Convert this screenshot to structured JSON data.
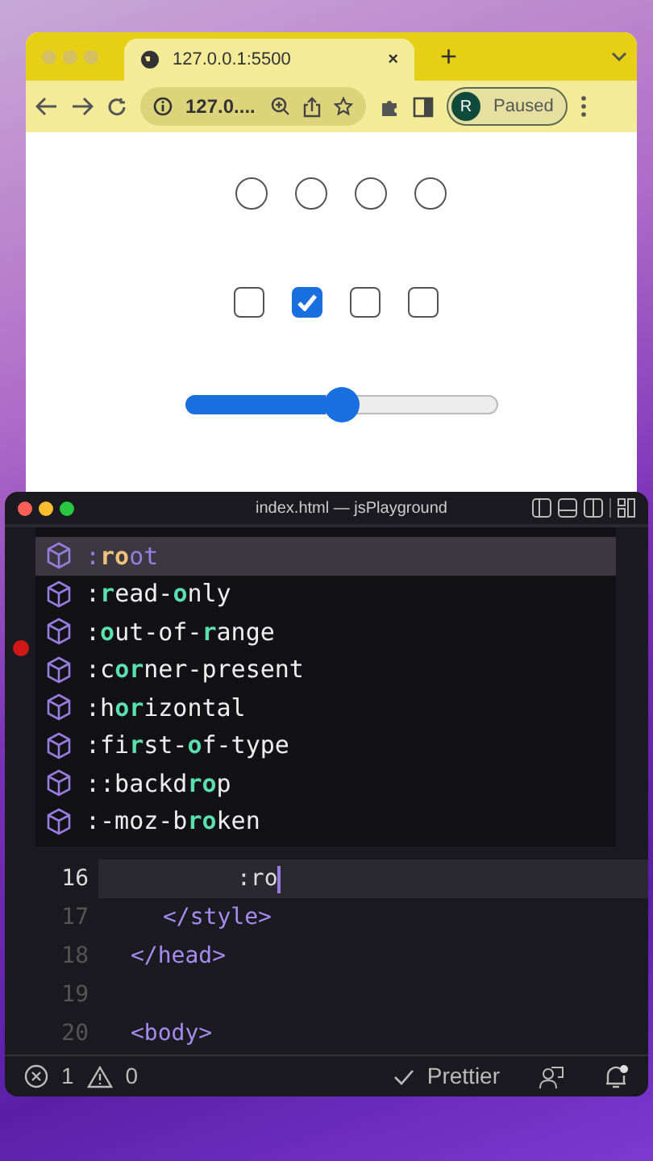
{
  "browser": {
    "tab": {
      "title": "127.0.0.1:5500",
      "close": "×"
    },
    "new_tab": "+",
    "address": "127.0....",
    "profile": {
      "initial": "R",
      "label": "Paused"
    }
  },
  "page": {
    "radios": [
      {
        "selected": false
      },
      {
        "selected": false
      },
      {
        "selected": false
      },
      {
        "selected": false
      }
    ],
    "checkboxes": [
      {
        "checked": false
      },
      {
        "checked": true
      },
      {
        "checked": false
      },
      {
        "checked": false
      }
    ],
    "slider": {
      "level": 0.5
    }
  },
  "editor": {
    "title": "index.html — jsPlayground",
    "suggestions": [
      {
        "label": ":**ro**ot",
        "selected": true
      },
      {
        "label": ":**r**ead-**o**nly",
        "selected": false
      },
      {
        "label": ":**o**ut-of-**r**ange",
        "selected": false
      },
      {
        "label": ":c**or**ner-present",
        "selected": false
      },
      {
        "label": ":h**or**izontal",
        "selected": false
      },
      {
        "label": ":fi**r**st-**o**f-type",
        "selected": false
      },
      {
        "label": "::backd**ro**p",
        "selected": false
      },
      {
        "label": ":-moz-b**ro**ken",
        "selected": false
      }
    ],
    "lines": [
      {
        "number": "16",
        "code": ":ro",
        "kind": "text",
        "current": true
      },
      {
        "number": "17",
        "code": "</style>",
        "kind": "tag",
        "current": false
      },
      {
        "number": "18",
        "code": "</head>",
        "kind": "tag",
        "current": false
      },
      {
        "number": "19",
        "kind": "blank",
        "current": false
      },
      {
        "number": "20",
        "code": "<body>",
        "kind": "tag",
        "current": false
      }
    ],
    "status": {
      "errors": "1",
      "warnings": "0",
      "formatter": "Prettier"
    }
  }
}
